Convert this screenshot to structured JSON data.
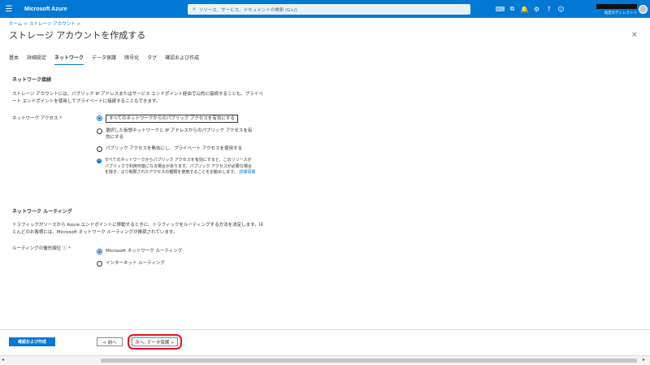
{
  "topbar": {
    "menu_icon": "hamburger-icon",
    "brand": "Microsoft Azure",
    "search_placeholder": "リソース、サービス、ドキュメントの検索 (G+/)",
    "icons": [
      "cloud-shell-icon",
      "directory-icon",
      "notifications-icon",
      "settings-icon",
      "help-icon",
      "feedback-icon"
    ],
    "user_sub": "既定のディレクトリ"
  },
  "breadcrumb": {
    "home": "ホーム",
    "storage": "ストレージ アカウント"
  },
  "page": {
    "title": "ストレージ アカウントを作成する",
    "more": "···",
    "close": "×"
  },
  "tabs": [
    "基本",
    "詳細設定",
    "ネットワーク",
    "データ保護",
    "暗号化",
    "タグ",
    "確認および作成"
  ],
  "network_connectivity": {
    "heading": "ネットワーク接続",
    "description_line1": "ストレージ アカウントには、パブリック IP アドレスまたはサービス エンドポイント経由で公的に接続することも、プライベ",
    "description_line2": "ート エンドポイントを使用してプライベートに接続することもできます。",
    "access_label": "ネットワーク アクセス *",
    "options": [
      "すべてのネットワークからのパブリック アクセスを有効にする",
      "選択した仮想ネットワークと IP アドレスからのパブリック アクセスを有効にする",
      "パブリック アクセスを無効にし、プライベート アクセスを使用する"
    ],
    "option2_line1": "選択した仮想ネットワークと IP アドレスからのパブリック アクセスを有",
    "option2_line2": "効にする",
    "info_line1": "すべてのネットワークからパブリック アクセスを有効にすると、このリソースが",
    "info_line2": "パブリックで利用可能になる場合があります。パブリック アクセスが必要な場合",
    "info_line3": "を除き、より制限されたアクセスの種類を使用することをお勧めします。",
    "info_link": "詳細情報"
  },
  "network_routing": {
    "heading": "ネットワーク ルーティング",
    "description_line1": "トラフィックがソースから Azure エンドポイントに移動するときに、トラフィックをルーティングする方法を決定します。ほ",
    "description_line2": "とんどのお客様には、Microsoft ネットワーク ルーティングが推奨されています。",
    "pref_label": "ルーティングの優先順位 ⓘ *",
    "options": [
      "Microsoft ネットワーク ルーティング",
      "インターネット ルーティング"
    ]
  },
  "footer": {
    "review_create": "確認および作成",
    "prev": "< 前へ",
    "next": "次へ: データ保護 >"
  }
}
